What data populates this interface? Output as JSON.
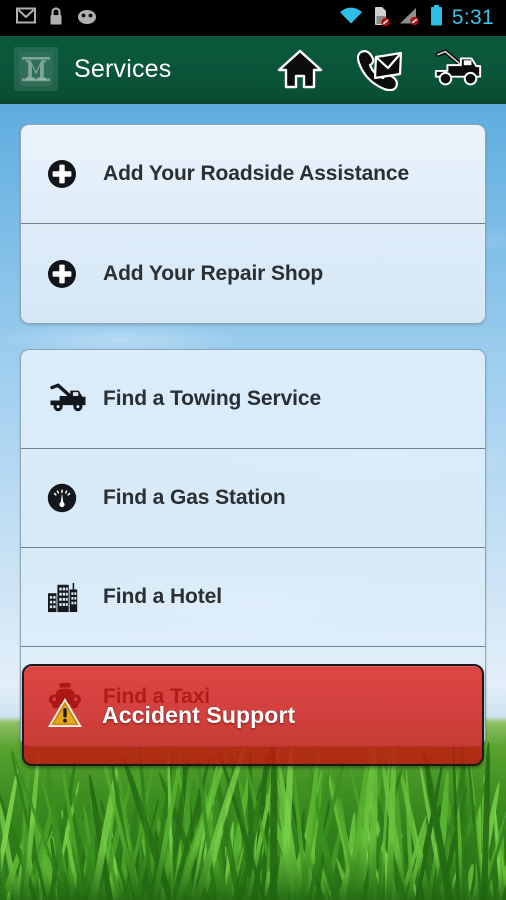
{
  "status_bar": {
    "time": "5:31",
    "left_icons": [
      "gmail-icon",
      "lock-icon",
      "android-icon"
    ],
    "right_icons": [
      "wifi-icon",
      "sd-card-off-icon",
      "signal-off-icon",
      "battery-icon"
    ],
    "accent_color": "#3fc0e8",
    "background_color": "#000000"
  },
  "appbar": {
    "title": "Services",
    "logo_letter": "M",
    "background_color": "#0a5539",
    "actions": [
      {
        "name": "home-icon",
        "label": "Home"
      },
      {
        "name": "contact-phone-icon",
        "label": "Contact"
      },
      {
        "name": "tow-truck-icon",
        "label": "Towing"
      }
    ]
  },
  "groups": [
    {
      "name": "add-services-group",
      "rows": [
        {
          "icon": "plus-circle-icon",
          "label": "Add Your Roadside Assistance"
        },
        {
          "icon": "plus-circle-icon",
          "label": "Add Your Repair Shop"
        }
      ]
    },
    {
      "name": "find-services-group",
      "rows": [
        {
          "icon": "tow-truck-icon",
          "label": "Find a Towing Service"
        },
        {
          "icon": "fuel-gauge-icon",
          "label": "Find a Gas Station"
        },
        {
          "icon": "buildings-icon",
          "label": "Find a Hotel"
        },
        {
          "icon": "taxi-icon",
          "label": "Find a Taxi"
        }
      ]
    }
  ],
  "accident_button": {
    "label": "Accident Support",
    "icon": "warning-triangle-icon",
    "color": "#d0160f",
    "text_color": "#ffffff"
  },
  "background": {
    "sky_color": "#3f9ad8",
    "grass_color": "#3f8f22"
  }
}
